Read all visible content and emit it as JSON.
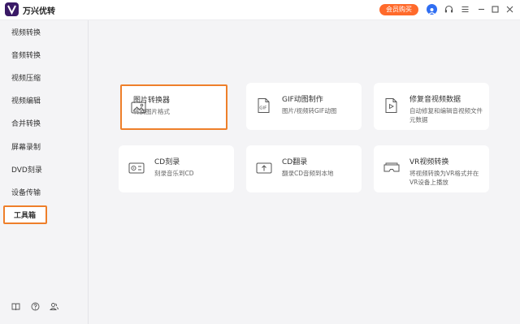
{
  "app": {
    "title": "万兴优转",
    "vip_label": "会员购买"
  },
  "sidebar": {
    "items": [
      {
        "label": "视频转换"
      },
      {
        "label": "音频转换"
      },
      {
        "label": "视频压缩"
      },
      {
        "label": "视频编辑"
      },
      {
        "label": "合并转换"
      },
      {
        "label": "屏幕录制"
      },
      {
        "label": "DVD刻录"
      },
      {
        "label": "设备传输"
      },
      {
        "label": "工具箱"
      }
    ],
    "active_item": "工具箱"
  },
  "tools": [
    {
      "title": "图片转换器",
      "desc": "转换图片格式",
      "icon": "image-icon"
    },
    {
      "title": "GIF动图制作",
      "desc": "图片/视频转GIF动图",
      "icon": "gif-icon"
    },
    {
      "title": "修复音视频数据",
      "desc": "自动修复和编辑音视频文件元数据",
      "icon": "video-fix-icon"
    },
    {
      "title": "CD刻录",
      "desc": "刻录音乐到CD",
      "icon": "cd-burn-icon"
    },
    {
      "title": "CD翻录",
      "desc": "翻录CD音频到本地",
      "icon": "cd-rip-icon"
    },
    {
      "title": "VR视频转换",
      "desc": "将视频转换为VR格式并在VR设备上播放",
      "icon": "vr-icon"
    }
  ],
  "colors": {
    "accent": "#ee7f2a",
    "vip": "#ff6a2b",
    "avatar": "#2f6ef2",
    "logo": "#3a1a66"
  }
}
